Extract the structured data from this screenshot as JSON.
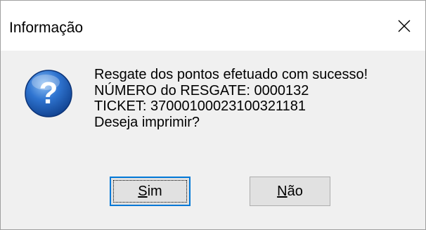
{
  "dialog": {
    "title": "Informação",
    "icon": "question-icon",
    "messages": [
      "Resgate dos pontos efetuado com sucesso!",
      "NÚMERO do RESGATE: 0000132",
      "TICKET: 37000100023100321181",
      "Deseja imprimir?"
    ],
    "buttons": {
      "yes": {
        "mnemonic": "S",
        "rest": "im",
        "default": true
      },
      "no": {
        "mnemonic": "N",
        "rest": "ão",
        "default": false
      }
    },
    "colors": {
      "focus_border": "#0078d7",
      "icon_blue": "#1c5fb8",
      "button_bg": "#e1e1e1",
      "dialog_bg": "#f0f0f0"
    }
  }
}
